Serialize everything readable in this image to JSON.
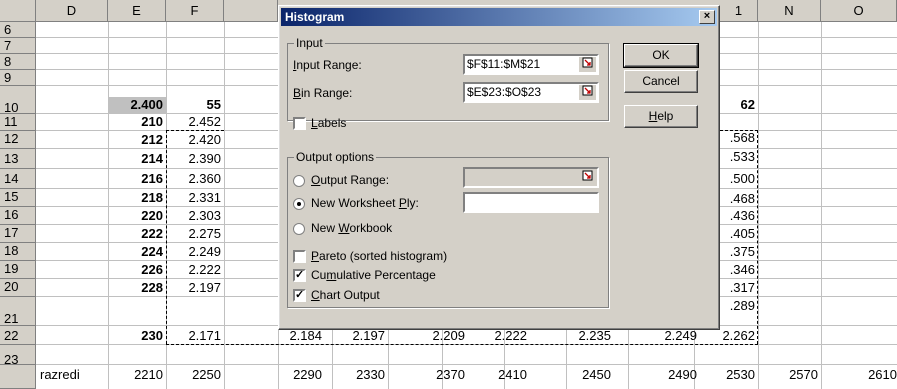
{
  "sheet": {
    "columns": [
      "D",
      "E",
      "F",
      "",
      "",
      "",
      "",
      "",
      "",
      "1",
      "N",
      "O"
    ],
    "rows": [
      "6",
      "7",
      "8",
      "9",
      "10",
      "11",
      "12",
      "13",
      "14",
      "15",
      "16",
      "17",
      "18",
      "19",
      "20",
      "21",
      "22",
      "23"
    ],
    "e10": "2.400",
    "f10": "55",
    "l10": "62",
    "col_e": [
      "210",
      "212",
      "214",
      "216",
      "218",
      "220",
      "222",
      "224",
      "226",
      "228",
      "230"
    ],
    "col_f": [
      "2.452",
      "2.420",
      "2.390",
      "2.360",
      "2.331",
      "2.303",
      "2.275",
      "2.249",
      "2.222",
      "2.197",
      "2.171"
    ],
    "col_m": [
      ".568",
      ".533",
      ".500",
      ".468",
      ".436",
      ".405",
      ".375",
      ".346",
      ".317",
      ".289",
      "2.262"
    ],
    "row21_mid": [
      "2.184",
      "2.197",
      "2.209",
      "2.222",
      "2.235",
      "2.249"
    ],
    "row23_label": "razredi",
    "row23_values": [
      "2210",
      "2250",
      "2290",
      "2330",
      "2370",
      "2410",
      "2450",
      "2490",
      "2530",
      "2570",
      "2610"
    ]
  },
  "dialog": {
    "title": "Histogram",
    "close_glyph": "×",
    "input_group": "Input",
    "input_range_label": "Input Range:",
    "input_range_value": "$F$11:$M$21",
    "bin_range_label": "Bin Range:",
    "bin_range_value": "$E$23:$O$23",
    "labels_label": "Labels",
    "output_group": "Output options",
    "output_range_label": "Output Range:",
    "new_ply_label": "New Worksheet Ply:",
    "new_workbook_label": "New Workbook",
    "pareto_label": "Pareto (sorted histogram)",
    "cumulative_label": "Cumulative Percentage",
    "chart_output_label": "Chart Output",
    "ok_label": "OK",
    "cancel_label": "Cancel",
    "help_label": "Help",
    "ref_icon": "range-select-icon"
  },
  "colors": {
    "titlebar": "#0a246a",
    "dialog_bg": "#d4d0c8"
  }
}
